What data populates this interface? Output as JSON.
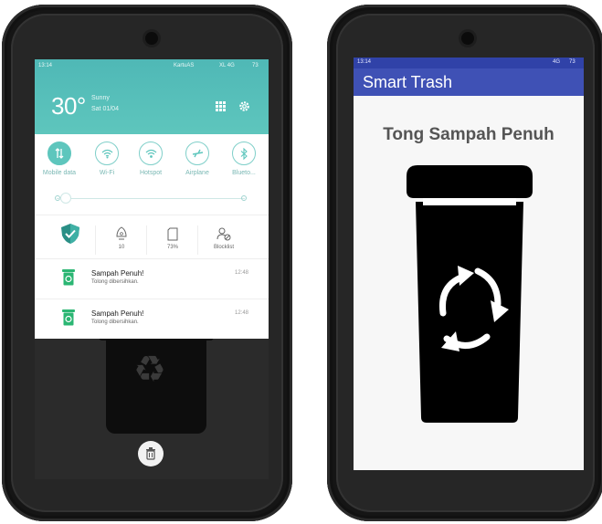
{
  "left_phone": {
    "status_bar": {
      "time": "13:14",
      "carrier": "KartuAS",
      "network": "XL 4G",
      "battery": "73"
    },
    "weather": {
      "temperature": "30°",
      "condition": "Sunny",
      "date": "Sat 01/04"
    },
    "quick_toggles": [
      {
        "label": "Mobile data",
        "icon": "data-arrows-icon",
        "active": true
      },
      {
        "label": "Wi-Fi",
        "icon": "wifi-icon",
        "active": false
      },
      {
        "label": "Hotspot",
        "icon": "hotspot-icon",
        "active": false
      },
      {
        "label": "Airplane",
        "icon": "airplane-icon",
        "active": false
      },
      {
        "label": "Blueto...",
        "icon": "bluetooth-icon",
        "active": false
      }
    ],
    "brightness_level": 0.05,
    "stats": [
      {
        "icon": "shield-icon",
        "value": ""
      },
      {
        "icon": "notification-bell-icon",
        "value": "10"
      },
      {
        "icon": "storage-icon",
        "value": "73%"
      },
      {
        "icon": "blocklist-icon",
        "value": "Blocklist"
      }
    ],
    "notifications": [
      {
        "title": "Sampah Penuh!",
        "body": "Tolong dibersihkan.",
        "time": "12:48"
      },
      {
        "title": "Sampah Penuh!",
        "body": "Tolong dibersihkan.",
        "time": "12:48"
      }
    ]
  },
  "right_phone": {
    "status_bar": {
      "time": "13:14",
      "network": "4G",
      "battery": "73"
    },
    "app_title": "Smart Trash",
    "heading": "Tong Sampah Penuh",
    "bin_icon": "recycle-trash-bin-icon"
  },
  "colors": {
    "teal": "#5ec6bd",
    "appbar": "#3f51b5",
    "statusbar": "#3042a8",
    "notif_green": "#2bb673"
  }
}
